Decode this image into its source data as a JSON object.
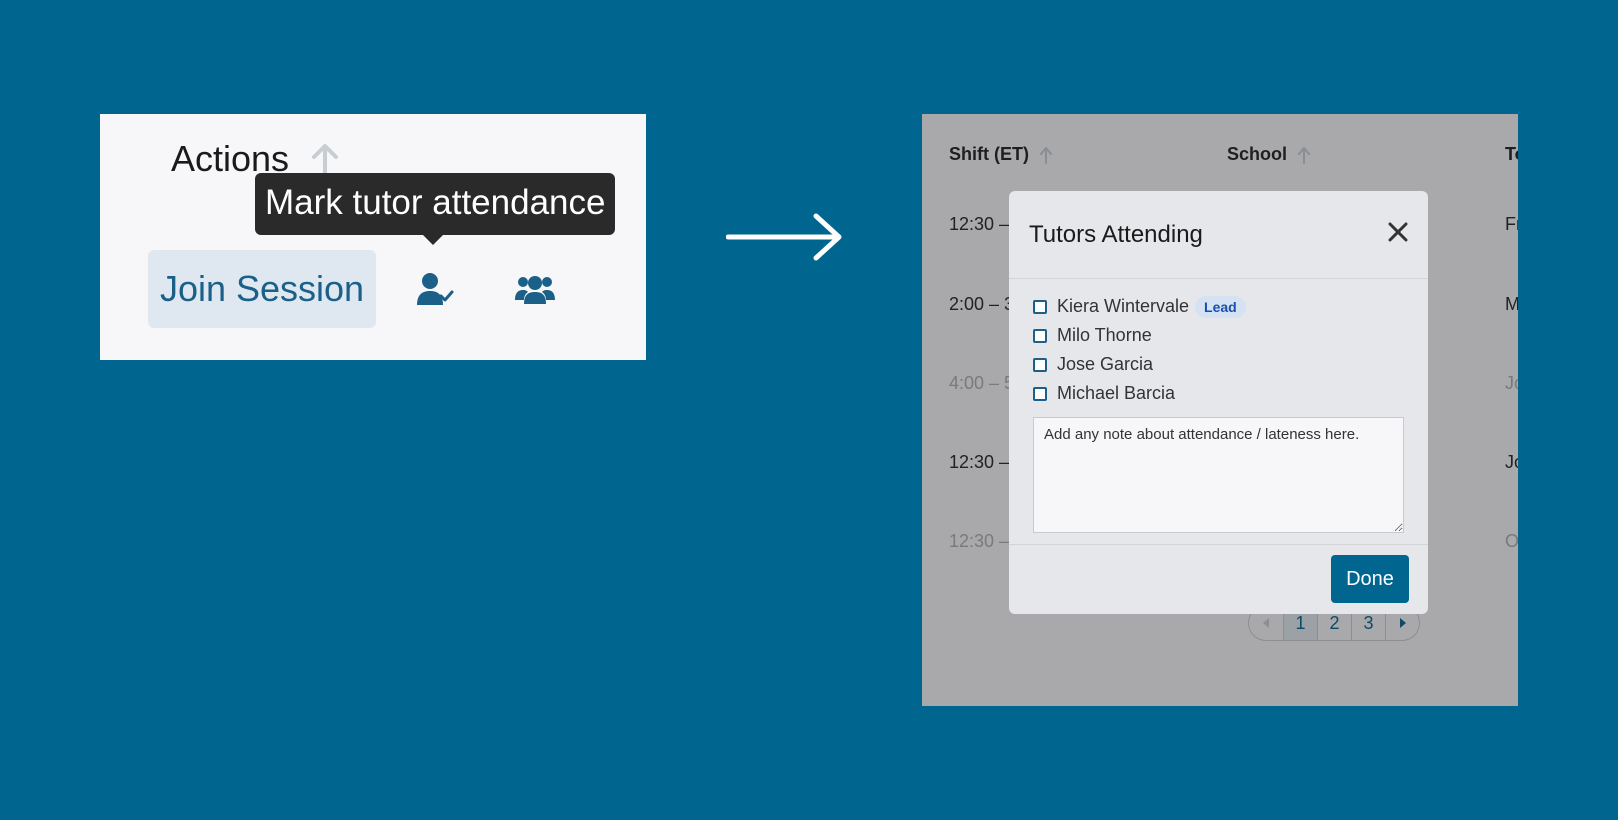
{
  "before": {
    "column_header": "Actions",
    "tooltip": "Mark tutor attendance",
    "join_button": "Join Session",
    "icons": [
      "user-check-icon",
      "users-group-icon"
    ]
  },
  "table": {
    "headers": [
      "Shift (ET)",
      "School",
      "To"
    ],
    "rows": [
      {
        "shift": "12:30 –",
        "tutor": "Fr",
        "dim": false
      },
      {
        "shift": "2:00 – 3",
        "tutor": "M",
        "dim": false
      },
      {
        "shift": "4:00 – 5",
        "tutor": "Jo",
        "dim": true
      },
      {
        "shift": "12:30 –",
        "tutor": "Jo",
        "dim": false
      },
      {
        "shift": "12:30 –",
        "tutor": "O",
        "dim": true
      }
    ],
    "pagination": {
      "pages": [
        "1",
        "2",
        "3"
      ],
      "current": "1"
    }
  },
  "modal": {
    "title": "Tutors Attending",
    "tutors": [
      {
        "name": "Kiera Wintervale",
        "badge": "Lead"
      },
      {
        "name": "Milo Thorne"
      },
      {
        "name": "Jose Garcia"
      },
      {
        "name": "Michael Barcia"
      }
    ],
    "note_placeholder": "Add any note about attendance / lateness here.",
    "done_label": "Done"
  },
  "colors": {
    "background": "#00658f",
    "accent": "#1a6088",
    "tooltip_bg": "#2a2a2a",
    "lead_badge_bg": "#d5e2f3"
  }
}
